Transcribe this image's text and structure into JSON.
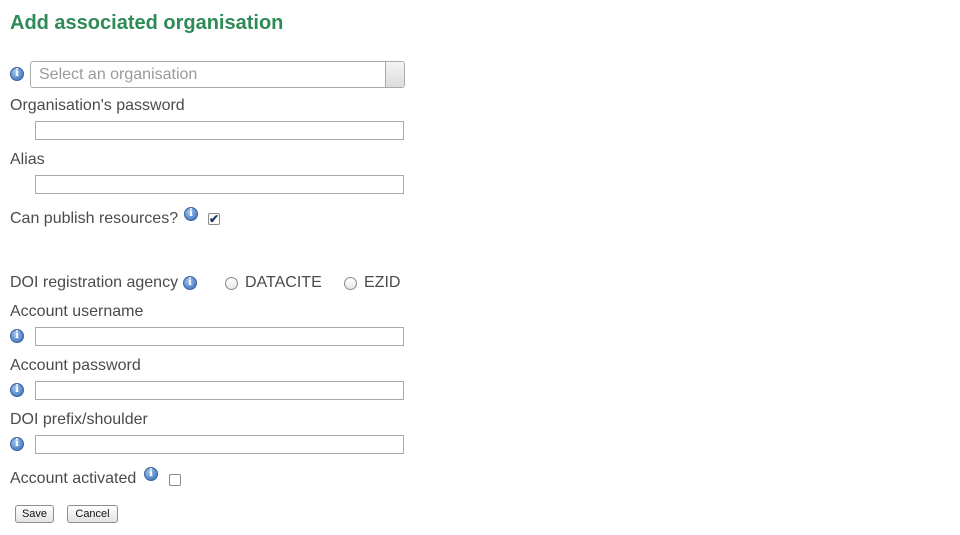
{
  "page": {
    "title": "Add associated organisation"
  },
  "form": {
    "organisation_select": {
      "placeholder": "Select an organisation"
    },
    "org_password": {
      "label": "Organisation's password",
      "value": ""
    },
    "alias": {
      "label": "Alias",
      "value": ""
    },
    "can_publish": {
      "label": "Can publish resources?",
      "checked": true,
      "check_glyph": "✔"
    },
    "doi_agency": {
      "label": "DOI registration agency",
      "options": [
        "DATACITE",
        "EZID"
      ]
    },
    "account_username": {
      "label": "Account username",
      "value": ""
    },
    "account_password": {
      "label": "Account password",
      "value": ""
    },
    "doi_prefix": {
      "label": "DOI prefix/shoulder",
      "value": ""
    },
    "account_activated": {
      "label": "Account activated",
      "checked": false
    },
    "info_glyph": "i"
  },
  "buttons": {
    "save": "Save",
    "cancel": "Cancel"
  }
}
